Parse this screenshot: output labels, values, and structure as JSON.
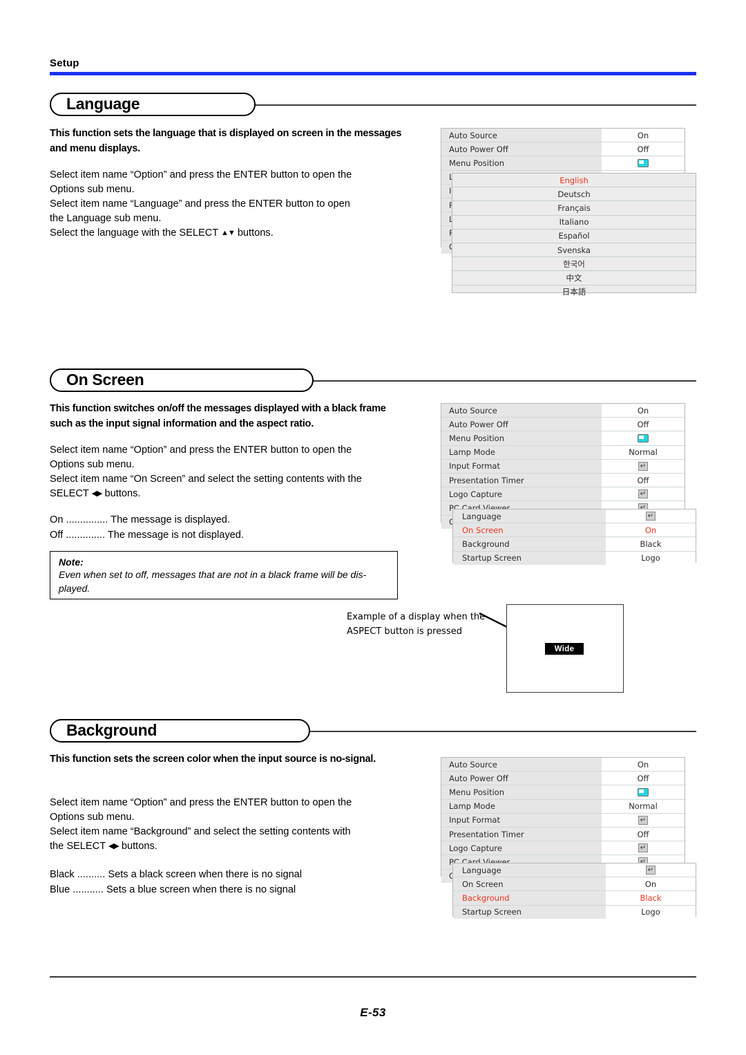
{
  "header": {
    "title": "Setup",
    "rule_color": "#1b30f0"
  },
  "footer": {
    "page": "E-53"
  },
  "sections": [
    {
      "title": "Language",
      "intro": "This function sets the language that is displayed on screen in the messages and menu displays.",
      "steps_line1": "Select item name “Option” and press the ENTER button to open the",
      "steps_line2": "Options sub menu.",
      "steps_line3": "Select item name “Language” and press the ENTER button to open",
      "steps_line4": "the Language sub menu.",
      "steps_line5_pre": "Select the language with the SELECT ",
      "steps_line5_arrows": "▲▼",
      "steps_line5_post": " buttons."
    },
    {
      "title": "On Screen",
      "intro": "This function switches on/off the messages displayed with a black frame such as the input signal information and the aspect ratio.",
      "steps_line1": "Select item name “Option” and press the ENTER button to open the",
      "steps_line2": "Options sub menu.",
      "steps_line3": "Select item name “On Screen” and select the setting contents with the",
      "steps_line4_pre": "SELECT ",
      "steps_line4_arrows": "◀▶",
      "steps_line4_post": " buttons.",
      "defs": [
        {
          "term": "On",
          "dots": "...............",
          "desc": "The message is displayed."
        },
        {
          "term": "Off",
          "dots": "..............",
          "desc": "The message is not displayed."
        }
      ],
      "note_label": "Note:",
      "note_text": "Even when set to off, messages that are not in a black frame will be dis-played."
    },
    {
      "title": "Background",
      "intro": "This function sets the screen color when the input source is no-signal.",
      "steps_line1": "Select item name “Option” and press the ENTER button to open the",
      "steps_line2": "Options sub menu.",
      "steps_line3": "Select item name “Background” and select the setting contents with",
      "steps_line4_pre": "the SELECT ",
      "steps_line4_arrows": "◀▶",
      "steps_line4_post": " buttons.",
      "defs": [
        {
          "term": "Black",
          "dots": "..........",
          "desc": "Sets a black screen when there is no signal"
        },
        {
          "term": "Blue",
          "dots": "...........",
          "desc": "Sets a blue screen when there is no signal"
        }
      ]
    }
  ],
  "osd": {
    "option_menu_rows": [
      {
        "label": "Auto Source",
        "value": "On",
        "icon": ""
      },
      {
        "label": "Auto Power Off",
        "value": "Off",
        "icon": ""
      },
      {
        "label": "Menu Position",
        "value": "",
        "icon": "menu-position-icon"
      },
      {
        "label": "Lamp Mode",
        "value": "Normal",
        "icon": ""
      },
      {
        "label": "Input Format",
        "value": "",
        "icon": "enter-icon"
      },
      {
        "label": "Presentation Timer",
        "value": "Off",
        "icon": ""
      },
      {
        "label": "Logo Capture",
        "value": "",
        "icon": "enter-icon"
      },
      {
        "label": "PC Card Viewer",
        "value": "",
        "icon": "enter-icon"
      },
      {
        "label": "Option",
        "value": "",
        "icon": "enter-icon"
      }
    ],
    "option_sub_rows": [
      {
        "label": "Language",
        "value": "",
        "icon": "enter-icon"
      },
      {
        "label": "On Screen",
        "value": "On",
        "icon": ""
      },
      {
        "label": "Background",
        "value": "Black",
        "icon": ""
      },
      {
        "label": "Startup Screen",
        "value": "Logo",
        "icon": ""
      }
    ],
    "language_list": [
      "English",
      "Deutsch",
      "Français",
      "Italiano",
      "Español",
      "Svenska",
      "한국어",
      "中文",
      "日本語"
    ],
    "language_selected": "English",
    "onscreen_selected": "On Screen",
    "background_selected": "Background",
    "selected_color": "#f1321e",
    "menu_position_icon_color": "#25d5dd"
  },
  "aspect_example": {
    "caption_line1": "Example of a display when the",
    "caption_line2": "ASPECT button is pressed",
    "badge_label": "Wide"
  }
}
